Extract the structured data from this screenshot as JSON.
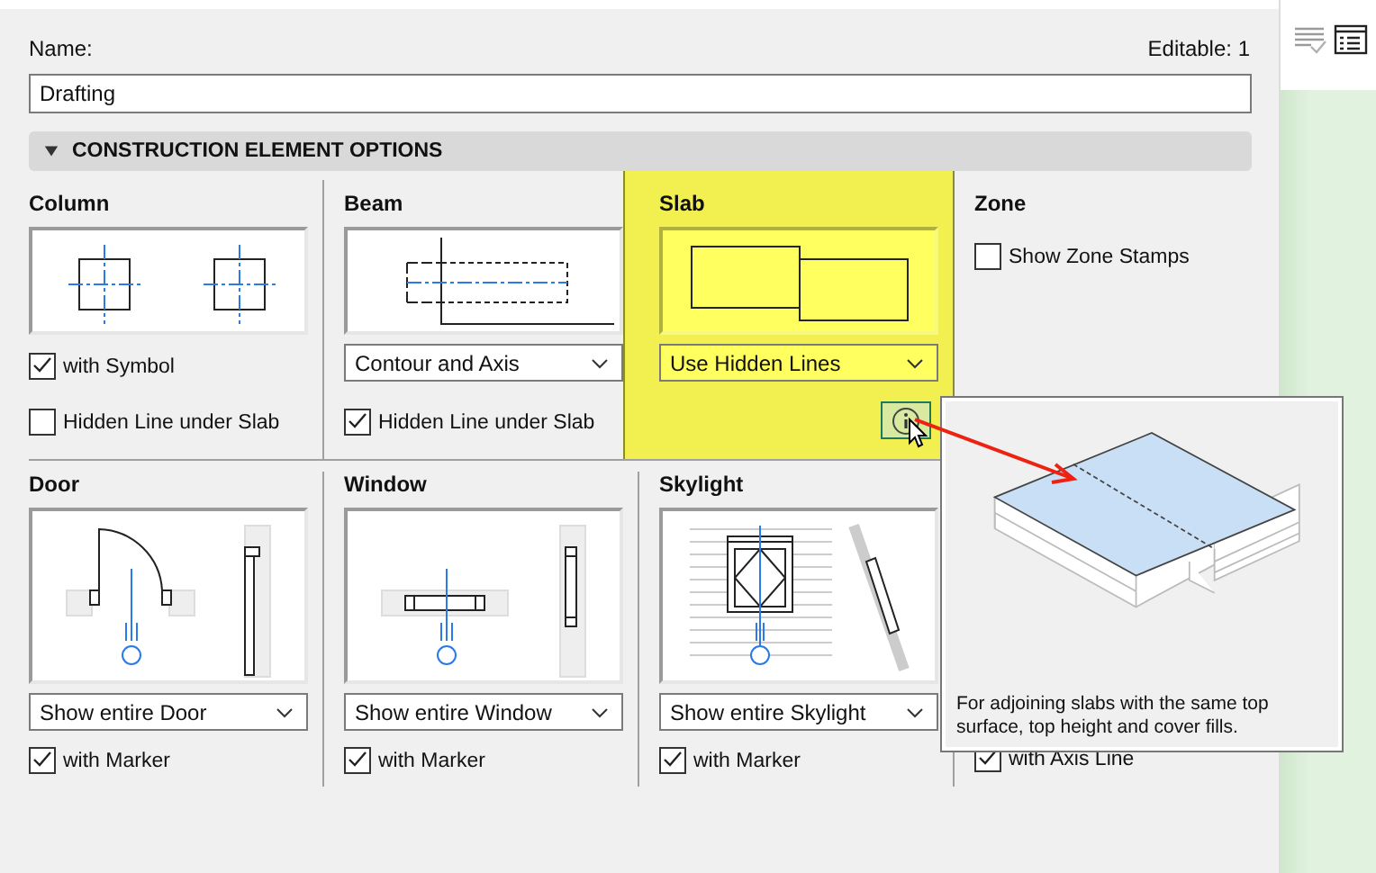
{
  "name_label": "Name:",
  "editable": "Editable: 1",
  "name_value": "Drafting",
  "section": {
    "title": "CONSTRUCTION ELEMENT OPTIONS",
    "expanded": true
  },
  "rows": [
    [
      {
        "kind": "column",
        "title": "Column",
        "highlighted": false,
        "checkboxes": [
          {
            "label": "with Symbol",
            "checked": true
          },
          {
            "label": "Hidden Line under Slab",
            "checked": false
          }
        ]
      },
      {
        "kind": "beam",
        "title": "Beam",
        "highlighted": false,
        "dropdown": "Contour and Axis",
        "checkboxes": [
          {
            "label": "Hidden Line under Slab",
            "checked": true
          }
        ]
      },
      {
        "kind": "slab",
        "title": "Slab",
        "highlighted": true,
        "dropdown": "Use Hidden Lines",
        "info_button": true
      },
      {
        "kind": "zone",
        "title": "Zone",
        "highlighted": false,
        "checkboxes": [
          {
            "label": "Show Zone Stamps",
            "checked": false
          }
        ]
      }
    ],
    [
      {
        "kind": "door",
        "title": "Door",
        "highlighted": false,
        "dropdown": "Show entire Door",
        "checkboxes": [
          {
            "label": "with Marker",
            "checked": true
          }
        ]
      },
      {
        "kind": "window",
        "title": "Window",
        "highlighted": false,
        "dropdown": "Show entire Window",
        "checkboxes": [
          {
            "label": "with Marker",
            "checked": true
          }
        ]
      },
      {
        "kind": "skylight",
        "title": "Skylight",
        "highlighted": false,
        "dropdown": "Show entire Skylight",
        "checkboxes": [
          {
            "label": "with Marker",
            "checked": true
          }
        ]
      },
      {
        "kind": "covered",
        "highlighted": false,
        "checkboxes": [
          {
            "label": "with Axis Line",
            "checked": true
          }
        ]
      }
    ]
  ],
  "tooltip": {
    "text": "For adjoining slabs with the same top surface, top height and cover fills."
  }
}
